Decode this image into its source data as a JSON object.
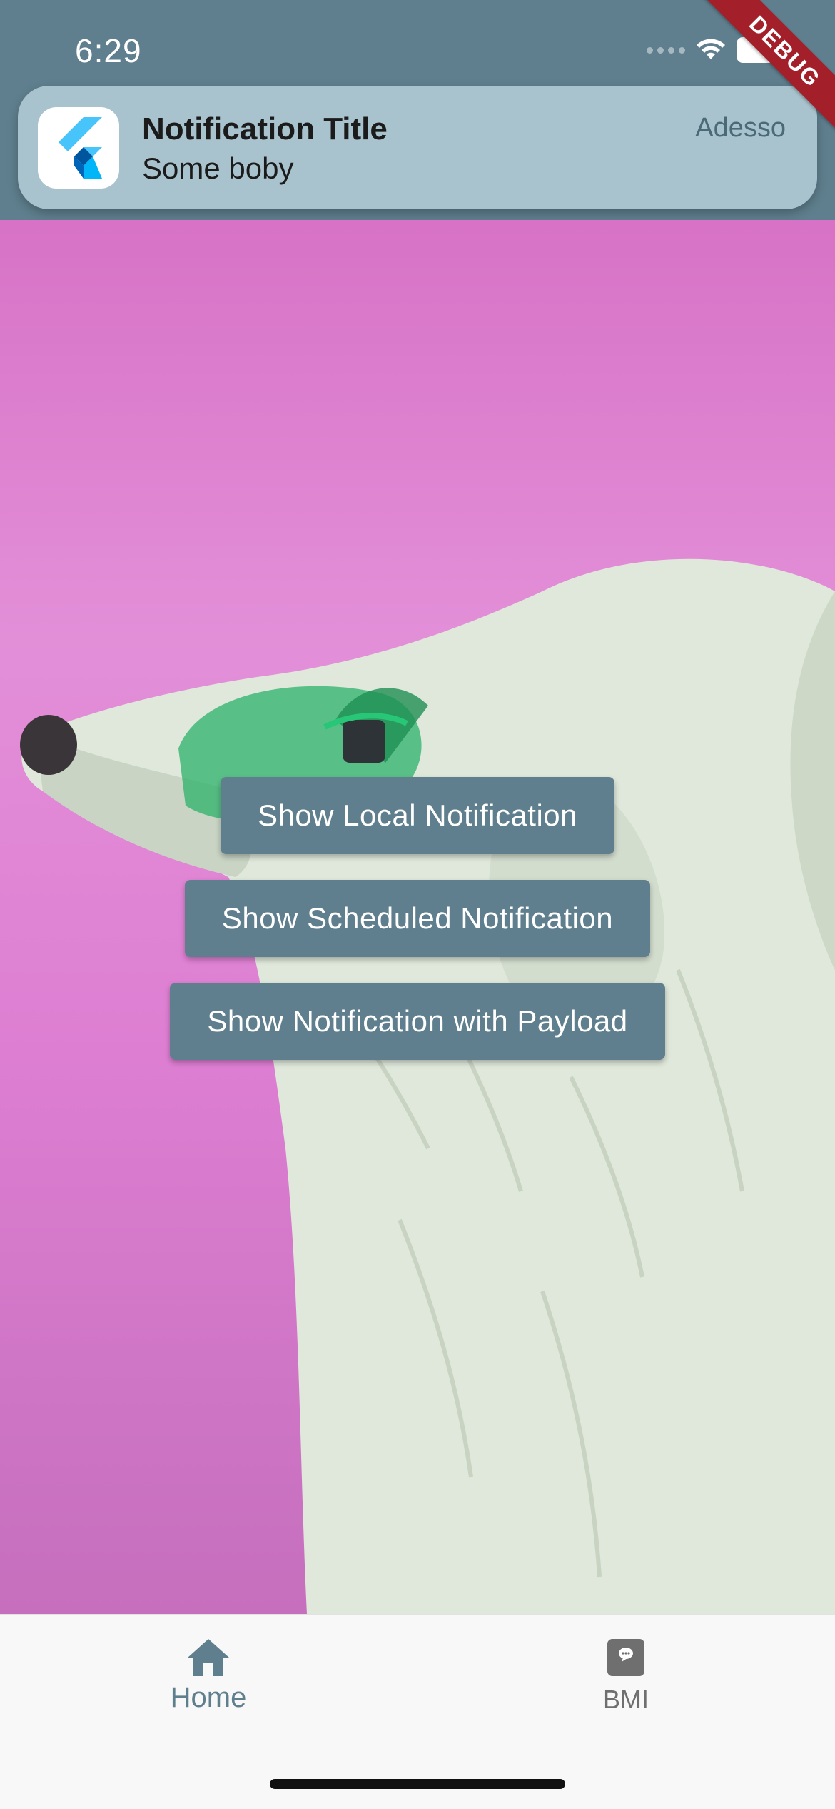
{
  "status_bar": {
    "time": "6:29"
  },
  "debug_banner": "DEBUG",
  "notification": {
    "title": "Notification Title",
    "body": "Some boby",
    "source": "Adesso",
    "app_icon": "flutter-logo-icon"
  },
  "actions": {
    "local": "Show Local Notification",
    "scheduled": "Show Scheduled Notification",
    "payload": "Show Notification with Payload"
  },
  "background_image": "golden retriever wearing green goggles on pink wall",
  "bottom_nav": {
    "items": [
      {
        "label": "Home",
        "icon": "home-icon",
        "active": true
      },
      {
        "label": "BMI",
        "icon": "bmi-book-icon",
        "active": false
      }
    ]
  },
  "colors": {
    "primary": "#5f7f8e",
    "notification_bg": "#a8c3cd",
    "background_pink": "#dd7ed2",
    "debug_ribbon": "#a3202b"
  }
}
